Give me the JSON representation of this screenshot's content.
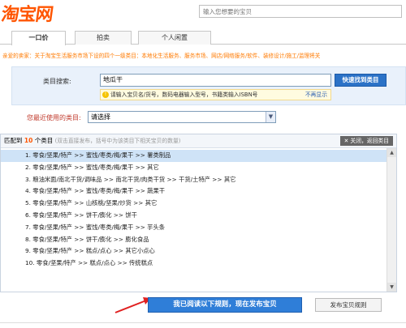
{
  "header": {
    "logo": "淘宝网",
    "search_placeholder": "输入您想要的宝贝"
  },
  "tabs": [
    {
      "label": "一口价"
    },
    {
      "label": "拍卖"
    },
    {
      "label": "个人闲置"
    }
  ],
  "notice": "亲爱的卖家：关于淘宝生活服务市场下设的四个一级类目：本地化生活服务、服务市场、网店/网络服务/软件、装修设计/施工/监理将关",
  "category": {
    "label": "类目搜索:",
    "value": "地瓜干",
    "quick_button": "快速找到类目",
    "tip": "请输入宝贝名/货号，数码电器输入型号，书籍类输入ISBN号",
    "tip_close": "不再显示"
  },
  "recent": {
    "label": "您最近使用的类目:",
    "selected": "请选择"
  },
  "results": {
    "prefix": "匹配到",
    "count": "10",
    "suffix": "个类目",
    "hint": "(双击直接发布，括号中为该类目下相关宝贝的数量)",
    "close_back": "关闭，返回类目",
    "items": [
      "1.  零食/坚果/特产 >> 蜜饯/枣类/梅/果干 >> 薯类制品",
      "2.  零食/坚果/特产 >> 蜜饯/枣类/梅/果干 >> 其它",
      "3.  粮油米面/南北干货/调味品 >> 南北干货/肉类干货 >> 干货/土特产 >> 其它",
      "4.  零食/坚果/特产 >> 蜜饯/枣类/梅/果干 >> 蔬果干",
      "5.  零食/坚果/特产 >> 山核桃/坚果/炒货 >> 其它",
      "6.  零食/坚果/特产 >> 饼干/膨化 >> 饼干",
      "7.  零食/坚果/特产 >> 蜜饯/枣类/梅/果干 >> 芋头条",
      "8.  零食/坚果/特产 >> 饼干/膨化 >> 膨化食品",
      "9.  零食/坚果/特产 >> 糕点/点心 >> 其它小点心",
      "10. 零食/坚果/特产 >> 糕点/点心 >> 传统糕点"
    ]
  },
  "footer": {
    "publish_button": "我已阅读以下规则，现在发布宝贝",
    "rules_link": "发布宝贝规则"
  },
  "colors": {
    "brand": "#ff5500",
    "primary_button": "#2f7ed8",
    "selected_row": "#cfe3f7"
  }
}
